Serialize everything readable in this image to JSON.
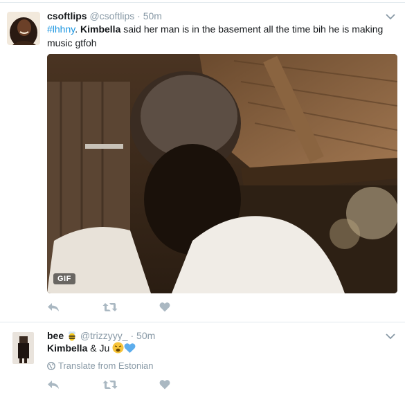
{
  "tweets": [
    {
      "fullname": "csoftlips",
      "username": "@csoftlips",
      "separator": "·",
      "time": "50m",
      "text": {
        "hashtag": "#lhhny",
        "after_hashtag": ". ",
        "bold_name": "Kimbella",
        "rest": " said her man is in the basement all the time bih he is making music gtfoh"
      },
      "media": {
        "badge": "GIF"
      },
      "actions": [
        "reply-icon",
        "retweet-icon",
        "like-icon"
      ]
    },
    {
      "fullname": "bee",
      "name_emoji": "bee-emoji",
      "username": "@trizzyyy_",
      "separator": "·",
      "time": "50m",
      "text": {
        "bold_name": "Kimbella",
        "rest": " & Ju",
        "emojis": [
          "weary-face-emoji",
          "blue-heart-emoji"
        ]
      },
      "translate": "Translate from Estonian",
      "actions": [
        "reply-icon",
        "retweet-icon",
        "like-icon"
      ]
    }
  ],
  "colors": {
    "link": "#1b95e0",
    "muted": "#8899a6",
    "icon": "#aab8c2",
    "heart": "#5dadec"
  }
}
